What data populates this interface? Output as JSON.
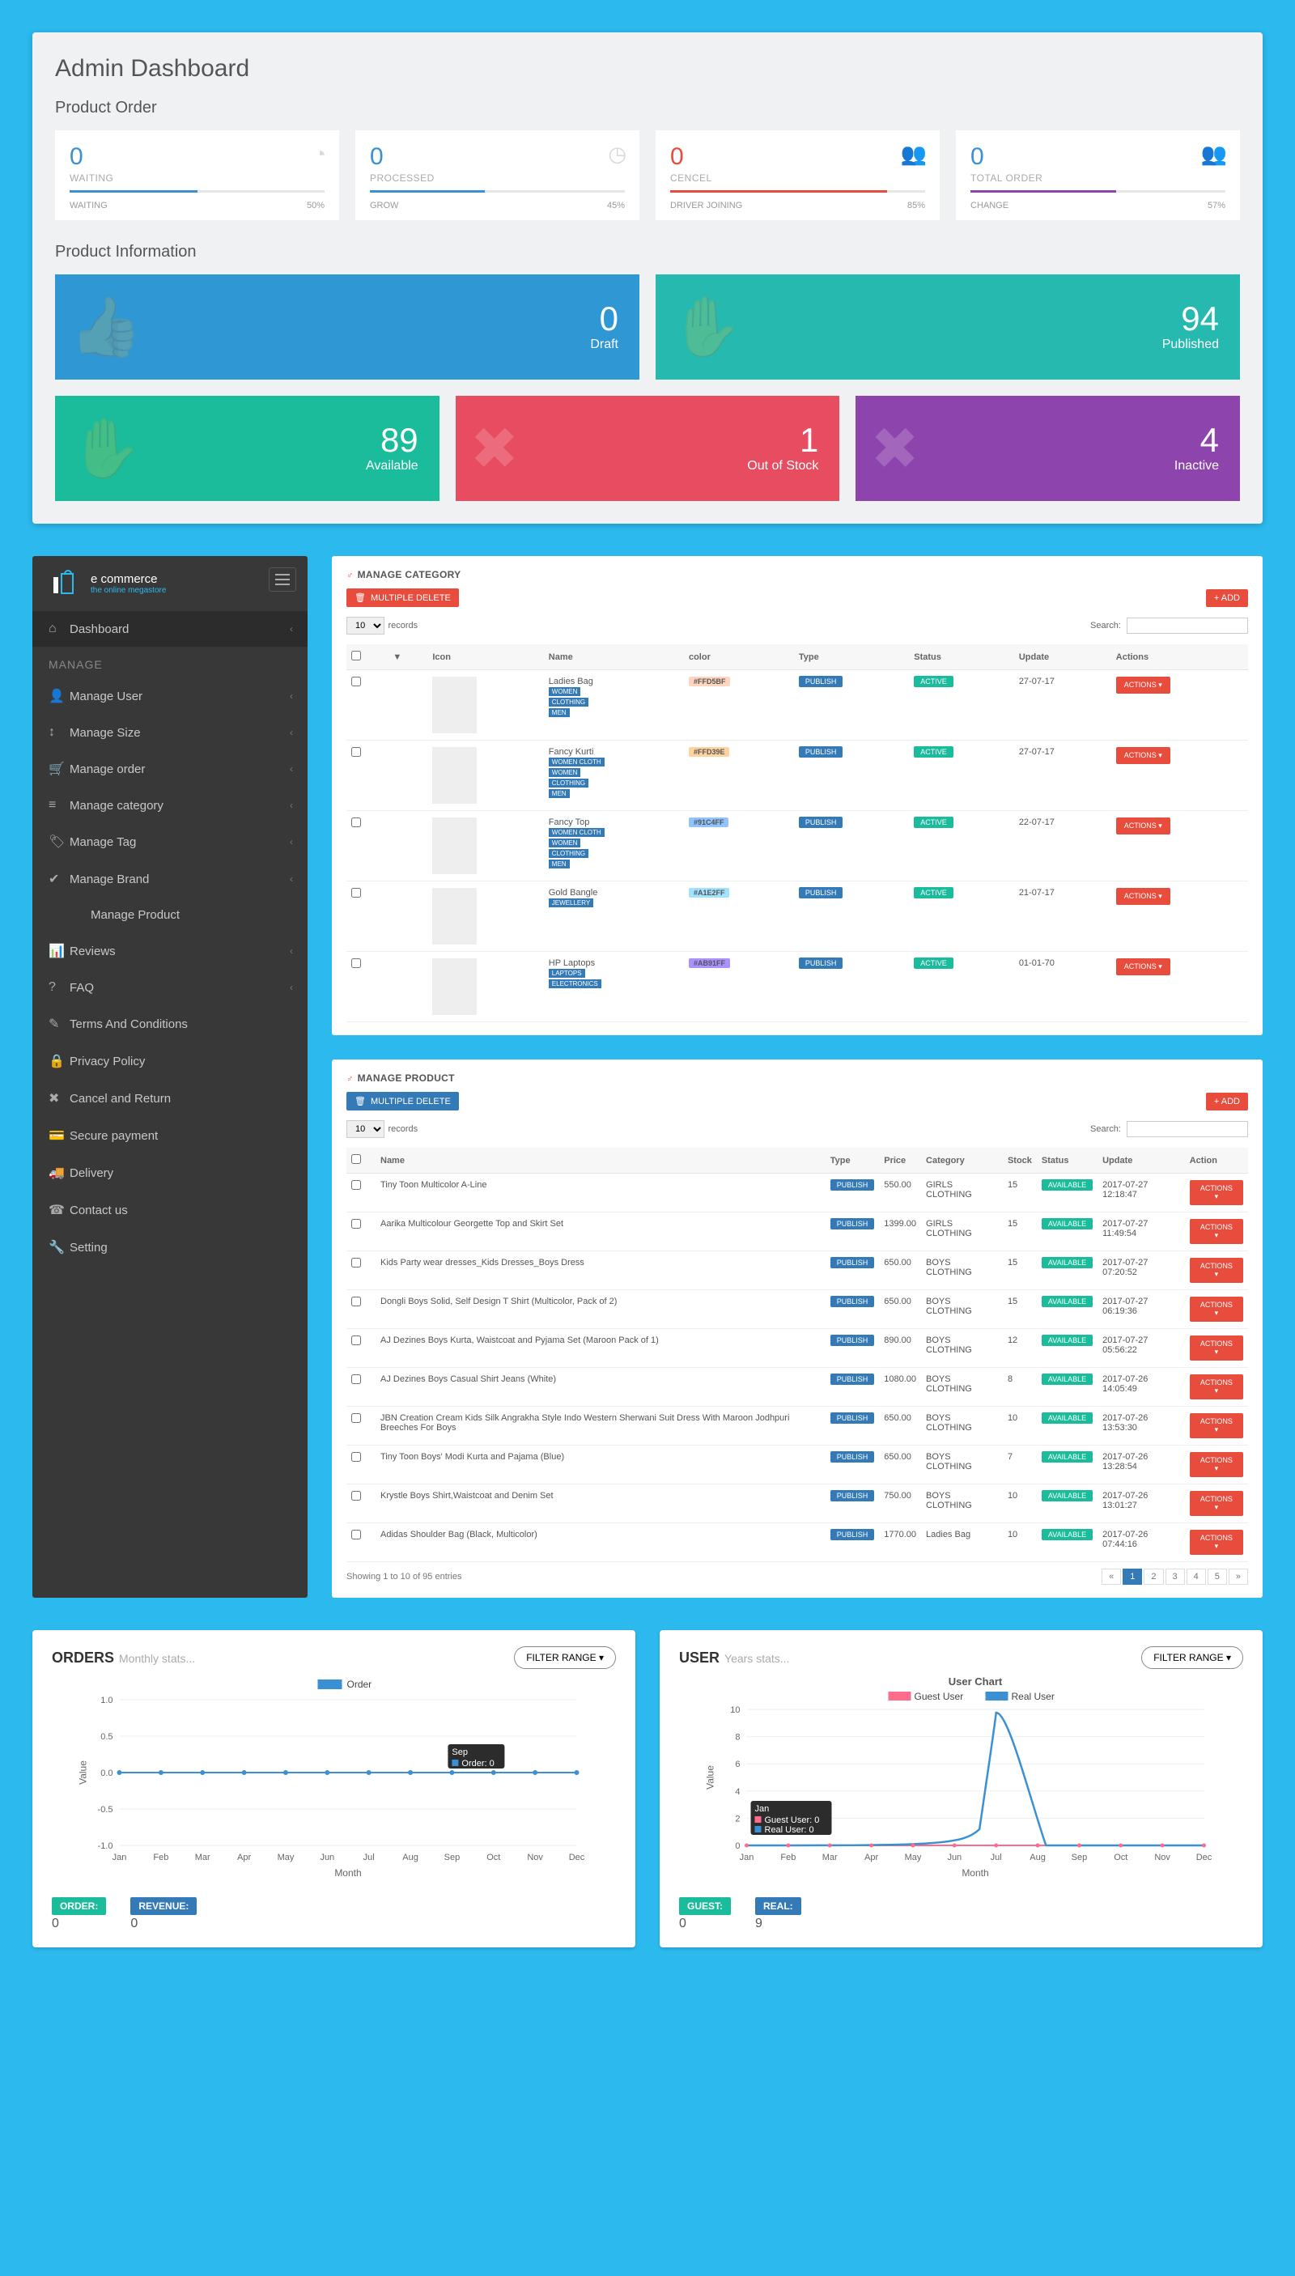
{
  "dashboard": {
    "title": "Admin Dashboard",
    "section1": "Product Order",
    "section2": "Product Information",
    "stats": [
      {
        "value": "0",
        "label": "WAITING",
        "foot": "WAITING",
        "pct": "50%",
        "bar": 50,
        "color": "#3b90d3"
      },
      {
        "value": "0",
        "label": "PROCESSED",
        "foot": "GROW",
        "pct": "45%",
        "bar": 45,
        "color": "#3b90d3"
      },
      {
        "value": "0",
        "label": "CENCEL",
        "foot": "DRIVER JOINING",
        "pct": "85%",
        "bar": 85,
        "color": "#e84c3d",
        "red": true
      },
      {
        "value": "0",
        "label": "TOTAL ORDER",
        "foot": "CHANGE",
        "pct": "57%",
        "bar": 57,
        "color": "#8e44ad"
      }
    ],
    "tilesTop": [
      {
        "num": "0",
        "lab": "Draft",
        "bg": "#2e97d4",
        "icon": "👍"
      },
      {
        "num": "94",
        "lab": "Published",
        "bg": "#25b9b0",
        "icon": "✋"
      }
    ],
    "tilesBottom": [
      {
        "num": "89",
        "lab": "Available",
        "bg": "#1abc9c",
        "icon": "✋"
      },
      {
        "num": "1",
        "lab": "Out of Stock",
        "bg": "#e84c60",
        "icon": "✖"
      },
      {
        "num": "4",
        "lab": "Inactive",
        "bg": "#8e44ad",
        "icon": "✖"
      }
    ]
  },
  "sidebar": {
    "brand": "e commerce",
    "tag": "the online megastore",
    "sectionLabel": "MANAGE",
    "items": [
      {
        "icon": "⌂",
        "label": "Dashboard",
        "chev": true,
        "dark": true
      },
      {
        "section": true,
        "label": "MANAGE"
      },
      {
        "icon": "👤",
        "label": "Manage User",
        "chev": true
      },
      {
        "icon": "↕",
        "label": "Manage Size",
        "chev": true
      },
      {
        "icon": "🛒",
        "label": "Manage order",
        "chev": true
      },
      {
        "icon": "≡",
        "label": "Manage category",
        "chev": true
      },
      {
        "icon": "🏷",
        "label": "Manage Tag",
        "chev": true
      },
      {
        "icon": "✔",
        "label": "Manage Brand",
        "chev": true
      },
      {
        "icon": "",
        "label": "Manage Product",
        "sub": true
      },
      {
        "icon": "📊",
        "label": "Reviews",
        "chev": true
      },
      {
        "icon": "?",
        "label": "FAQ",
        "chev": true
      },
      {
        "icon": "✎",
        "label": "Terms And Conditions"
      },
      {
        "icon": "🔒",
        "label": "Privacy Policy"
      },
      {
        "icon": "✖",
        "label": "Cancel and Return"
      },
      {
        "icon": "💳",
        "label": "Secure payment"
      },
      {
        "icon": "🚚",
        "label": "Delivery"
      },
      {
        "icon": "☎",
        "label": "Contact us"
      },
      {
        "icon": "🔧",
        "label": "Setting"
      }
    ]
  },
  "manageCategory": {
    "title": "MANAGE CATEGORY",
    "multiDelete": "MULTIPLE DELETE",
    "add": "+ ADD",
    "recordsLabel": "records",
    "recordsValue": "10",
    "searchLabel": "Search:",
    "headers": [
      "",
      "▼",
      "Icon",
      "Name",
      "color",
      "Type",
      "Status",
      "Update",
      "Actions"
    ],
    "rows": [
      {
        "name": "Ladies Bag",
        "tags": [
          "WOMEN",
          "CLOTHING",
          "MEN"
        ],
        "color": "#FFD5BF",
        "colorBg": "#FFD5BF",
        "type": "PUBLISH",
        "status": "ACTIVE",
        "update": "27-07-17"
      },
      {
        "name": "Fancy Kurti",
        "tags": [
          "WOMEN CLOTH",
          "WOMEN",
          "CLOTHING",
          "MEN"
        ],
        "color": "#FFD39E",
        "colorBg": "#FFD39E",
        "type": "PUBLISH",
        "status": "ACTIVE",
        "update": "27-07-17"
      },
      {
        "name": "Fancy Top",
        "tags": [
          "WOMEN CLOTH",
          "WOMEN",
          "CLOTHING",
          "MEN"
        ],
        "color": "#91C4FF",
        "colorBg": "#91C4FF",
        "type": "PUBLISH",
        "status": "ACTIVE",
        "update": "22-07-17"
      },
      {
        "name": "Gold Bangle",
        "tags": [
          "JEWELLERY"
        ],
        "color": "#A1E2FF",
        "colorBg": "#A1E2FF",
        "type": "PUBLISH",
        "status": "ACTIVE",
        "update": "21-07-17"
      },
      {
        "name": "HP Laptops",
        "tags": [
          "LAPTOPS",
          "ELECTRONICS"
        ],
        "color": "#AB91FF",
        "colorBg": "#AB91FF",
        "type": "PUBLISH",
        "status": "ACTIVE",
        "update": "01-01-70"
      }
    ],
    "actionLabel": "ACTIONS ▾"
  },
  "manageProduct": {
    "title": "MANAGE PRODUCT",
    "multiDelete": "MULTIPLE DELETE",
    "add": "+ ADD",
    "recordsLabel": "records",
    "recordsValue": "10",
    "searchLabel": "Search:",
    "headers": [
      "",
      "",
      "Name",
      "Type",
      "Price",
      "Category",
      "Stock",
      "Status",
      "Update",
      "Action"
    ],
    "rows": [
      {
        "name": "Tiny Toon Multicolor A-Line",
        "type": "PUBLISH",
        "price": "550.00",
        "cat": "GIRLS CLOTHING",
        "stock": "15",
        "status": "AVAILABLE",
        "update": "2017-07-27 12:18:47"
      },
      {
        "name": "Aarika Multicolour Georgette Top and Skirt Set",
        "type": "PUBLISH",
        "price": "1399.00",
        "cat": "GIRLS CLOTHING",
        "stock": "15",
        "status": "AVAILABLE",
        "update": "2017-07-27 11:49:54"
      },
      {
        "name": "Kids Party wear dresses_Kids Dresses_Boys Dress",
        "type": "PUBLISH",
        "price": "650.00",
        "cat": "BOYS CLOTHING",
        "stock": "15",
        "status": "AVAILABLE",
        "update": "2017-07-27 07:20:52"
      },
      {
        "name": "Dongli Boys Solid, Self Design T Shirt (Multicolor, Pack of 2)",
        "type": "PUBLISH",
        "price": "650.00",
        "cat": "BOYS CLOTHING",
        "stock": "15",
        "status": "AVAILABLE",
        "update": "2017-07-27 06:19:36"
      },
      {
        "name": "AJ Dezines Boys Kurta, Waistcoat and Pyjama Set (Maroon Pack of 1)",
        "type": "PUBLISH",
        "price": "890.00",
        "cat": "BOYS CLOTHING",
        "stock": "12",
        "status": "AVAILABLE",
        "update": "2017-07-27 05:56:22"
      },
      {
        "name": "AJ Dezines Boys Casual Shirt Jeans (White)",
        "type": "PUBLISH",
        "price": "1080.00",
        "cat": "BOYS CLOTHING",
        "stock": "8",
        "status": "AVAILABLE",
        "update": "2017-07-26 14:05:49"
      },
      {
        "name": "JBN Creation Cream Kids Silk Angrakha Style Indo Western Sherwani Suit Dress With Maroon Jodhpuri Breeches For Boys",
        "type": "PUBLISH",
        "price": "650.00",
        "cat": "BOYS CLOTHING",
        "stock": "10",
        "status": "AVAILABLE",
        "update": "2017-07-26 13:53:30"
      },
      {
        "name": "Tiny Toon Boys' Modi Kurta and Pajama (Blue)",
        "type": "PUBLISH",
        "price": "650.00",
        "cat": "BOYS CLOTHING",
        "stock": "7",
        "status": "AVAILABLE",
        "update": "2017-07-26 13:28:54"
      },
      {
        "name": "Krystle Boys Shirt,Waistcoat and Denim Set",
        "type": "PUBLISH",
        "price": "750.00",
        "cat": "BOYS CLOTHING",
        "stock": "10",
        "status": "AVAILABLE",
        "update": "2017-07-26 13:01:27"
      },
      {
        "name": "Adidas Shoulder Bag (Black, Multicolor)",
        "type": "PUBLISH",
        "price": "1770.00",
        "cat": "Ladies Bag",
        "stock": "10",
        "status": "AVAILABLE",
        "update": "2017-07-26 07:44:16"
      }
    ],
    "actionLabel": "ACTIONS ▾",
    "showing": "Showing 1 to 10 of 95 entries",
    "pages": [
      "«",
      "1",
      "2",
      "3",
      "4",
      "5",
      "»"
    ]
  },
  "orderChart": {
    "title": "ORDERS",
    "sub": "Monthly stats...",
    "filter": "FILTER RANGE ▾",
    "legend": "Order",
    "tooltip": {
      "m": "Sep",
      "line": "Order: 0"
    },
    "metrics": [
      {
        "label": "ORDER:",
        "val": "0",
        "color": "#1abc9c"
      },
      {
        "label": "REVENUE:",
        "val": "0",
        "color": "#337ab7"
      }
    ],
    "ylabel": "Value",
    "xlabel": "Month"
  },
  "userChart": {
    "title": "USER",
    "sub": "Years stats...",
    "filter": "FILTER RANGE ▾",
    "chartTitle": "User Chart",
    "legend": [
      {
        "c": "#ff6b8a",
        "l": "Guest User"
      },
      {
        "c": "#3b90d3",
        "l": "Real User"
      }
    ],
    "tooltip": {
      "m": "Jan",
      "l1": "Guest User: 0",
      "l2": "Real User: 0"
    },
    "metrics": [
      {
        "label": "GUEST:",
        "val": "0",
        "color": "#1abc9c"
      },
      {
        "label": "REAL:",
        "val": "9",
        "color": "#337ab7"
      }
    ],
    "ylabel": "Value",
    "xlabel": "Month"
  },
  "months": [
    "Jan",
    "Feb",
    "Mar",
    "Apr",
    "May",
    "Jun",
    "Jul",
    "Aug",
    "Sep",
    "Oct",
    "Nov",
    "Dec"
  ],
  "chart_data": [
    {
      "type": "line",
      "title": "ORDERS Monthly stats",
      "xlabel": "Month",
      "ylabel": "Value",
      "ylim": [
        -1,
        1
      ],
      "categories": [
        "Jan",
        "Feb",
        "Mar",
        "Apr",
        "May",
        "Jun",
        "Jul",
        "Aug",
        "Sep",
        "Oct",
        "Nov",
        "Dec"
      ],
      "series": [
        {
          "name": "Order",
          "values": [
            0,
            0,
            0,
            0,
            0,
            0,
            0,
            0,
            0,
            0,
            0,
            0
          ]
        }
      ]
    },
    {
      "type": "line",
      "title": "User Chart",
      "xlabel": "Month",
      "ylabel": "Value",
      "ylim": [
        0,
        10
      ],
      "categories": [
        "Jan",
        "Feb",
        "Mar",
        "Apr",
        "May",
        "Jun",
        "Jul",
        "Aug",
        "Sep",
        "Oct",
        "Nov",
        "Dec"
      ],
      "series": [
        {
          "name": "Guest User",
          "values": [
            0,
            0,
            0,
            0,
            0,
            0,
            0,
            0,
            0,
            0,
            0,
            0
          ]
        },
        {
          "name": "Real User",
          "values": [
            0,
            0,
            0,
            0,
            0,
            0,
            9,
            0,
            0,
            0,
            0,
            0
          ]
        }
      ]
    }
  ]
}
